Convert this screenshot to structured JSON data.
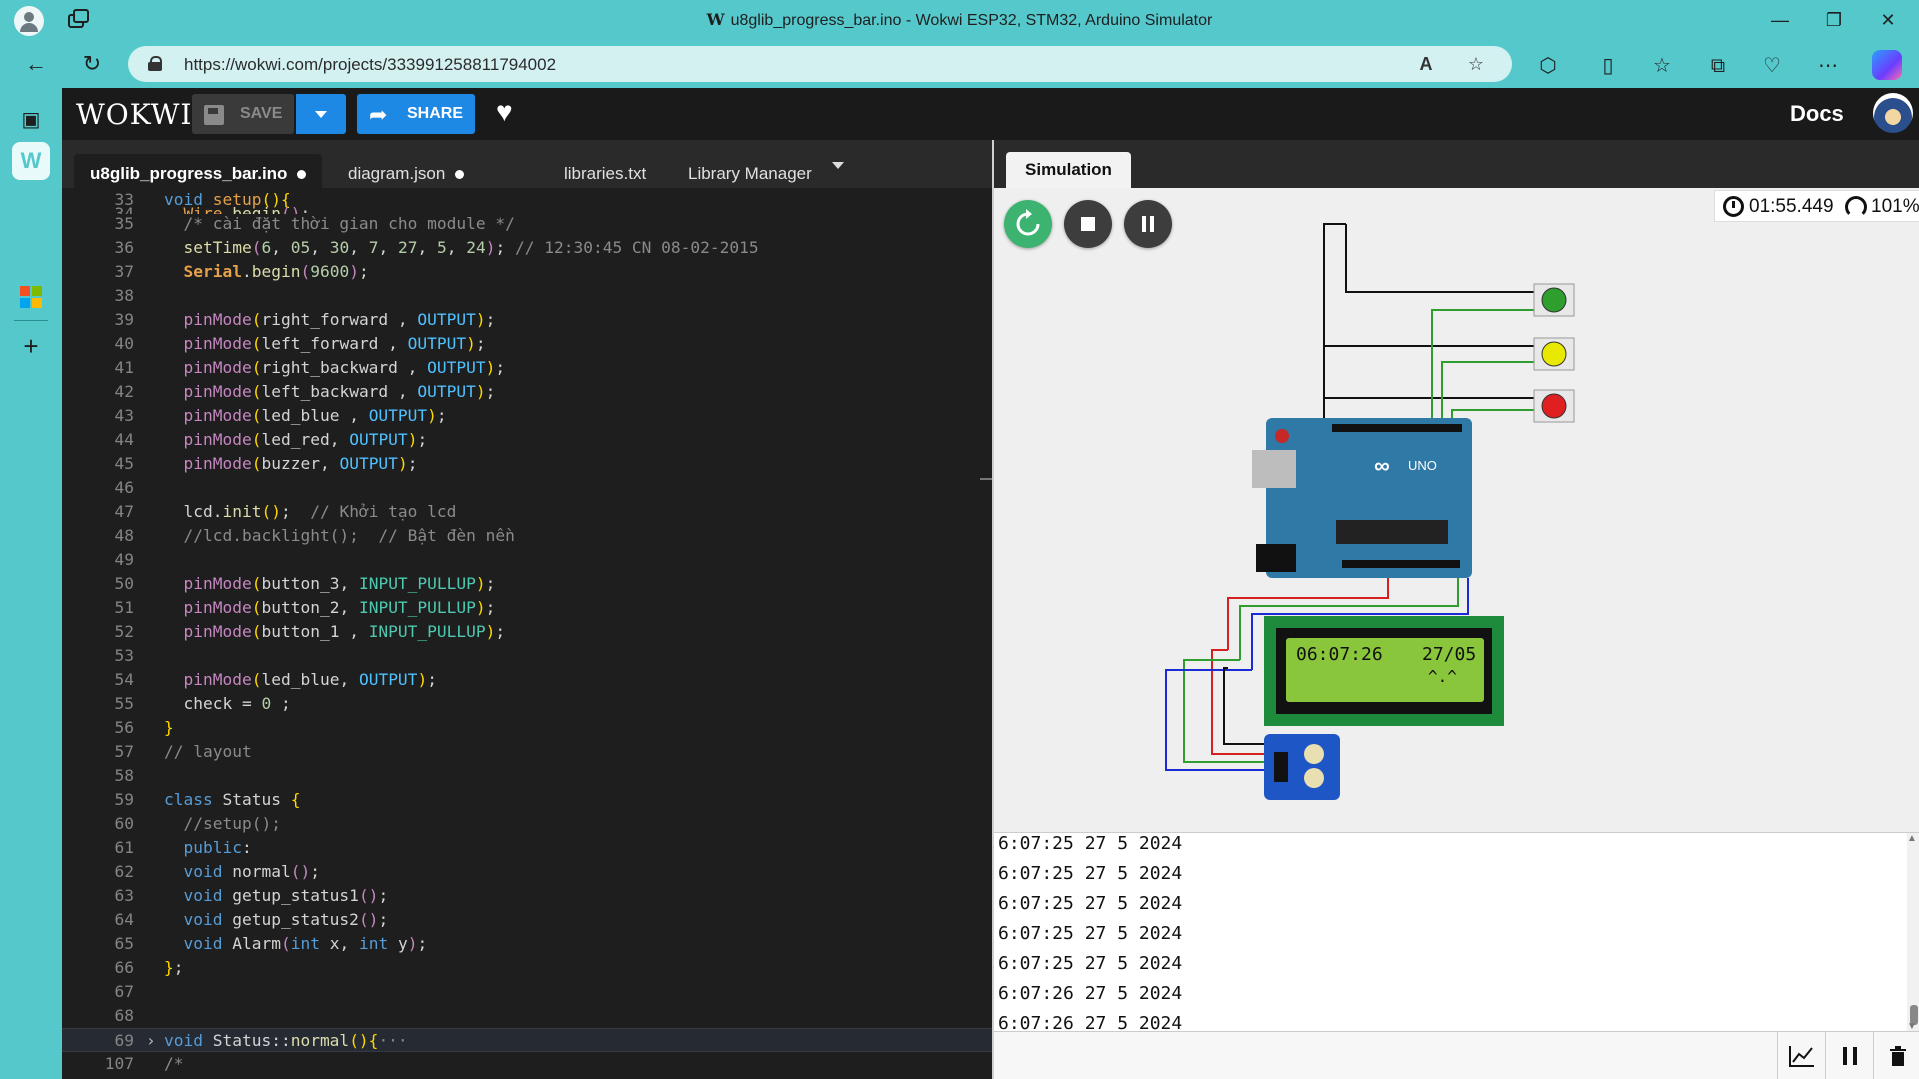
{
  "window": {
    "title": "u8glib_progress_bar.ino - Wokwi ESP32, STM32, Arduino Simulator",
    "minimize": "—",
    "maximize": "❐",
    "close": "✕"
  },
  "browser": {
    "url": "https://wokwi.com/projects/333991258811794002"
  },
  "header": {
    "logo": "WOKWI",
    "save_label": "SAVE",
    "share_label": "SHARE",
    "docs_label": "Docs"
  },
  "editor": {
    "tabs": [
      {
        "label": "u8glib_progress_bar.ino",
        "modified": true
      },
      {
        "label": "diagram.json",
        "modified": true
      },
      {
        "label": "libraries.txt",
        "modified": false
      },
      {
        "label": "Library Manager",
        "modified": false
      }
    ]
  },
  "simulation": {
    "tab_label": "Simulation",
    "time": "01:55.449",
    "speed": "101%",
    "lcd_time": "06:07:26",
    "lcd_date": "27/05",
    "lcd_face": "^.^",
    "arduino_model": "UNO",
    "led_colors": [
      "#2e9e2e",
      "#e8e800",
      "#e02020"
    ]
  },
  "serial": {
    "lines": [
      "6:07:25 27 5 2024",
      "6:07:25 27 5 2024",
      "6:07:25 27 5 2024",
      "6:07:25 27 5 2024",
      "6:07:25 27 5 2024",
      "6:07:26 27 5 2024",
      "6:07:26 27 5 2024"
    ]
  },
  "colors": {
    "accent": "#1e88e5",
    "browser": "#55c8cc",
    "restart": "#3cb371",
    "control": "#3d3d3d"
  }
}
